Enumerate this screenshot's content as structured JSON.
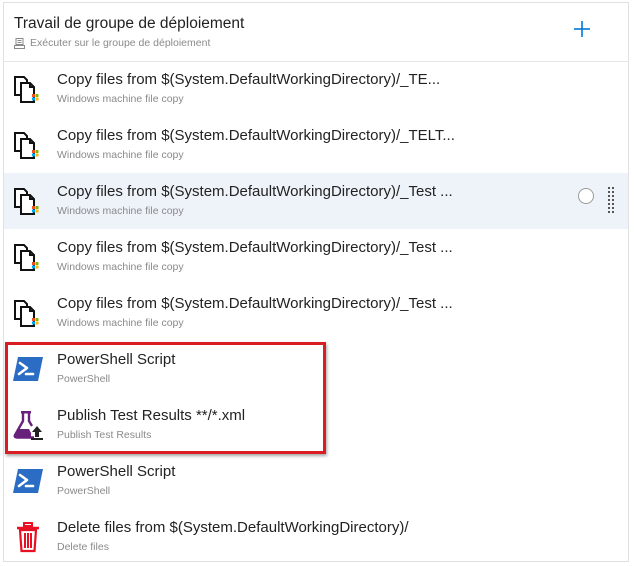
{
  "phase": {
    "title": "Travail de groupe de déploiement",
    "subtitle": "Exécuter sur le groupe de déploiement"
  },
  "tasks": [
    {
      "title": "Copy files from $(System.DefaultWorkingDirectory)/_TE...",
      "subtitle": "Windows machine file copy",
      "icon": "windows-file-copy-icon",
      "selected": false
    },
    {
      "title": "Copy files from $(System.DefaultWorkingDirectory)/_TELT...",
      "subtitle": "Windows machine file copy",
      "icon": "windows-file-copy-icon",
      "selected": false
    },
    {
      "title": "Copy files from $(System.DefaultWorkingDirectory)/_Test ...",
      "subtitle": "Windows machine file copy",
      "icon": "windows-file-copy-icon",
      "selected": true
    },
    {
      "title": "Copy files from $(System.DefaultWorkingDirectory)/_Test ...",
      "subtitle": "Windows machine file copy",
      "icon": "windows-file-copy-icon",
      "selected": false
    },
    {
      "title": "Copy files from $(System.DefaultWorkingDirectory)/_Test ...",
      "subtitle": "Windows machine file copy",
      "icon": "windows-file-copy-icon",
      "selected": false
    },
    {
      "title": "PowerShell Script",
      "subtitle": "PowerShell",
      "icon": "powershell-icon",
      "selected": false
    },
    {
      "title": "Publish Test Results **/*.xml",
      "subtitle": "Publish Test Results",
      "icon": "flask-upload-icon",
      "selected": false
    },
    {
      "title": "PowerShell Script",
      "subtitle": "PowerShell",
      "icon": "powershell-icon",
      "selected": false
    },
    {
      "title": "Delete files from $(System.DefaultWorkingDirectory)/",
      "subtitle": "Delete files",
      "icon": "trash-icon",
      "selected": false
    }
  ],
  "colors": {
    "selected_bg": "#eef3fa",
    "highlight_border": "#d81e22",
    "add_icon": "#0078d4",
    "powershell_blue": "#2b6cc4",
    "flask_purple": "#68217a",
    "trash_red": "#e81123"
  }
}
